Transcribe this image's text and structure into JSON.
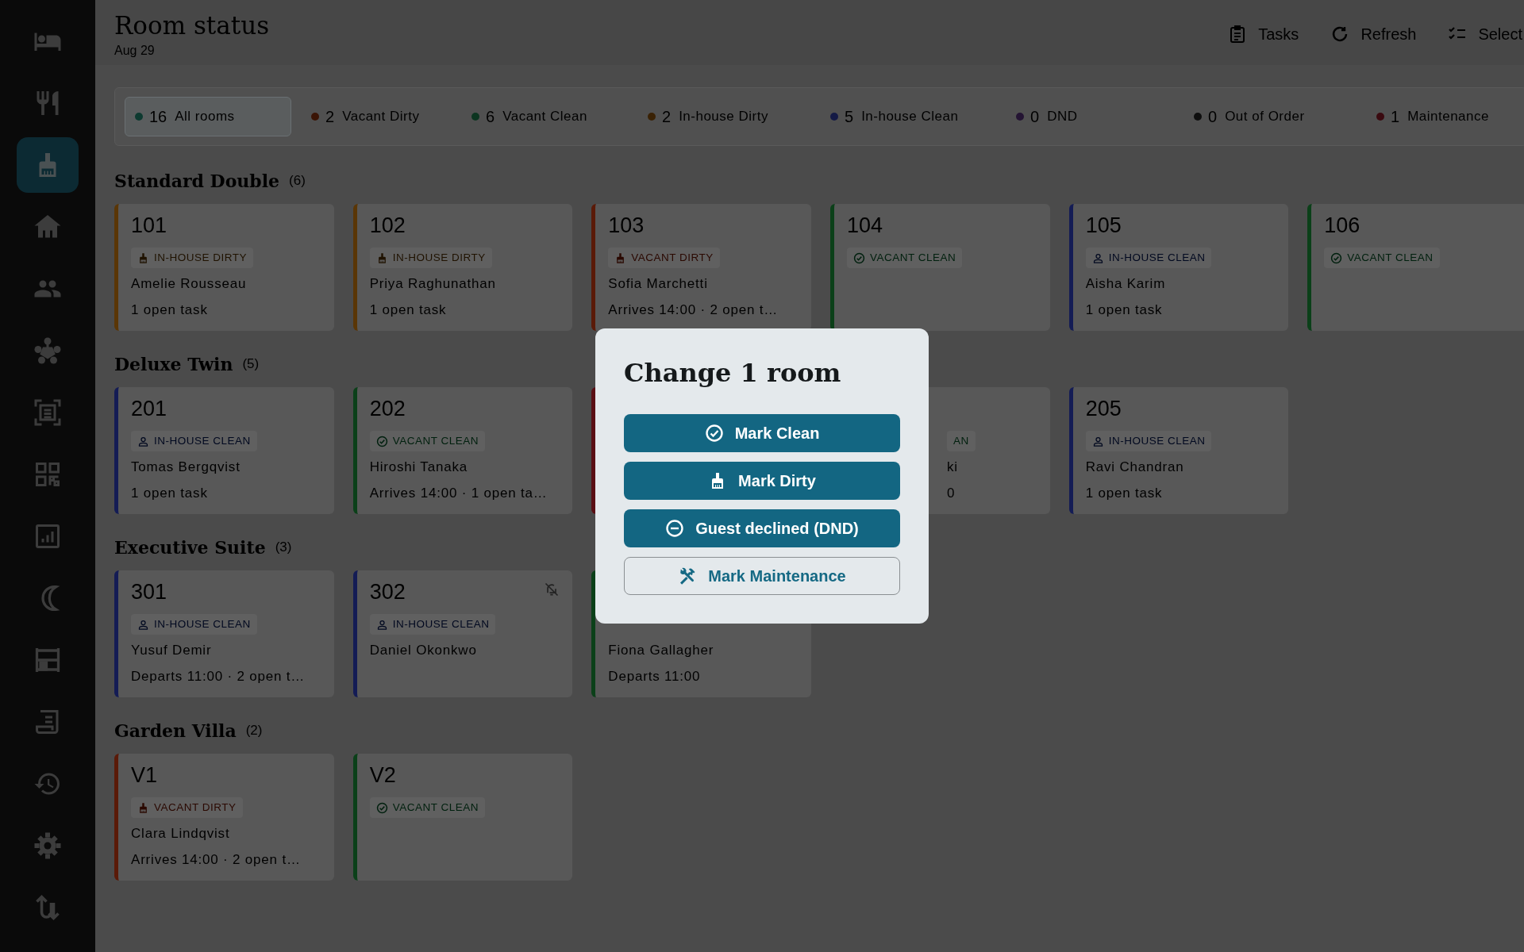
{
  "sidebar": [
    {
      "kind": "bed",
      "selected": false
    },
    {
      "kind": "dining",
      "selected": false
    },
    {
      "kind": "broom",
      "selected": true
    },
    {
      "kind": "house",
      "selected": false
    },
    {
      "kind": "people",
      "selected": false
    },
    {
      "kind": "network",
      "selected": false
    },
    {
      "kind": "scan",
      "selected": false
    },
    {
      "kind": "qr",
      "selected": false
    },
    {
      "kind": "report",
      "selected": false
    },
    {
      "kind": "moon",
      "selected": false
    },
    {
      "kind": "shelves",
      "selected": false
    },
    {
      "kind": "receipt",
      "selected": false
    },
    {
      "kind": "history",
      "selected": false
    },
    {
      "kind": "gear",
      "selected": false
    },
    {
      "kind": "swap",
      "selected": false
    }
  ],
  "header": {
    "title": "Room status",
    "date": "Aug 29",
    "actions": [
      {
        "kind": "tasks",
        "label": "Tasks"
      },
      {
        "kind": "refresh",
        "label": "Refresh"
      },
      {
        "kind": "select",
        "label": "Select"
      }
    ]
  },
  "filters": [
    {
      "count": "16",
      "label": "All rooms",
      "color": "#0d3a30",
      "selected": true
    },
    {
      "count": "2",
      "label": "Vacant Dirty",
      "color": "#3a1405",
      "selected": false
    },
    {
      "count": "6",
      "label": "Vacant Clean",
      "color": "#0c3520",
      "selected": false
    },
    {
      "count": "2",
      "label": "In-house Dirty",
      "color": "#3a2205",
      "selected": false
    },
    {
      "count": "5",
      "label": "In-house Clean",
      "color": "#141a45",
      "selected": false
    },
    {
      "count": "0",
      "label": "DND",
      "color": "#241433",
      "selected": false
    },
    {
      "count": "0",
      "label": "Out of Order",
      "color": "#0e0e0e",
      "selected": false
    },
    {
      "count": "1",
      "label": "Maintenance",
      "color": "#3a0a10",
      "selected": false
    }
  ],
  "sections": [
    {
      "name": "Standard Double",
      "count": "(6)",
      "rooms": [
        {
          "number": "101",
          "kind": "in-house-dirty",
          "badge": "IN-HOUSE DIRTY",
          "guest": "Amelie Rousseau",
          "details": "1 open task",
          "bell_off": false
        },
        {
          "number": "102",
          "kind": "in-house-dirty",
          "badge": "IN-HOUSE DIRTY",
          "guest": "Priya Raghunathan",
          "details": "1 open task",
          "bell_off": false
        },
        {
          "number": "103",
          "kind": "vacant-dirty",
          "badge": "VACANT DIRTY",
          "guest": "Sofia Marchetti",
          "details": "Arrives 14:00 · 2 open t…",
          "bell_off": false
        },
        {
          "number": "104",
          "kind": "vacant-clean",
          "badge": "VACANT CLEAN",
          "bell_off": false
        },
        {
          "number": "105",
          "kind": "in-house-clean",
          "badge": "IN-HOUSE CLEAN",
          "guest": "Aisha Karim",
          "details": "1 open task",
          "bell_off": false
        },
        {
          "number": "106",
          "kind": "vacant-clean",
          "badge": "VACANT CLEAN",
          "bell_off": false
        }
      ]
    },
    {
      "name": "Deluxe Twin",
      "count": "(5)",
      "rooms": [
        {
          "number": "201",
          "kind": "in-house-clean",
          "badge": "IN-HOUSE CLEAN",
          "guest": "Tomas Bergqvist",
          "details": "1 open task",
          "bell_off": false
        },
        {
          "number": "202",
          "kind": "vacant-clean",
          "badge": "VACANT CLEAN",
          "guest": "Hiroshi Tanaka",
          "details": "Arrives 14:00 · 1 open ta…",
          "bell_off": false
        },
        {
          "kind": "maintenance"
        },
        {
          "kind": "vacant-clean",
          "covered": true,
          "badge": "AN",
          "guest": "ki",
          "details": "0",
          "bell_off": false
        },
        {
          "number": "205",
          "kind": "in-house-clean",
          "badge": "IN-HOUSE CLEAN",
          "guest": "Ravi Chandran",
          "details": "1 open task",
          "bell_off": false
        }
      ]
    },
    {
      "name": "Executive Suite",
      "count": "(3)",
      "rooms": [
        {
          "number": "301",
          "kind": "in-house-clean",
          "badge": "IN-HOUSE CLEAN",
          "guest": "Yusuf Demir",
          "details": "Departs 11:00 · 2 open t…",
          "bell_off": false
        },
        {
          "number": "302",
          "kind": "in-house-clean",
          "badge": "IN-HOUSE CLEAN",
          "guest": "Daniel Okonkwo",
          "bell_off": true
        },
        {
          "kind": "vacant-clean",
          "guest": "Fiona Gallagher",
          "details": "Departs 11:00",
          "bell_off": false
        }
      ]
    },
    {
      "name": "Garden Villa",
      "count": "(2)",
      "rooms": [
        {
          "number": "V1",
          "kind": "vacant-dirty",
          "badge": "VACANT DIRTY",
          "guest": "Clara Lindqvist",
          "details": "Arrives 14:00 · 2 open t…",
          "bell_off": false
        },
        {
          "number": "V2",
          "kind": "vacant-clean",
          "badge": "VACANT CLEAN",
          "bell_off": false
        }
      ]
    }
  ],
  "dialog": {
    "title": "Change 1 room",
    "buttons": [
      {
        "kind": "clean",
        "label": "Mark Clean",
        "outlined": false
      },
      {
        "kind": "dirty",
        "label": "Mark Dirty",
        "outlined": false
      },
      {
        "kind": "dnd",
        "label": "Guest declined (DND)",
        "outlined": false
      },
      {
        "kind": "maintenance",
        "label": "Mark Maintenance",
        "outlined": true
      }
    ]
  }
}
